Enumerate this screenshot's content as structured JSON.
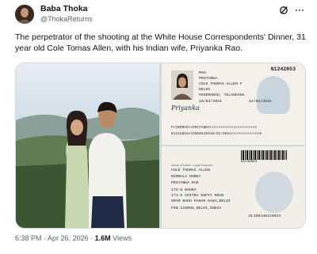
{
  "author": {
    "display_name": "Baba Thoka",
    "handle": "@ThokaReturns"
  },
  "header_icons": [
    "grok-icon",
    "more-icon"
  ],
  "tweet": {
    "text": "The perpetrator of the shooting at the White House Correspondents' Dinner, 31 year old Cole Tomas Allen, with his Indian wife, Priyanka Rao."
  },
  "passport_front": {
    "number": "N1242853",
    "fields": [
      "RAO",
      "PRIYANKA",
      "COLE THOMAS ALLEN F",
      "DELHI",
      "HYDERABAD, TELANGANA",
      "19/04/2024",
      "14/04/2034"
    ],
    "signature": "Priyanka",
    "mrz_line1": "P<INDRAO<<PRIYANKA<<<<<<<<<<<<<<<<<<<<<<",
    "mrz_line2": "N1242853<4IND6610910/02/0954<<<<<<<<<<<<<0"
  },
  "passport_back": {
    "number": "N1242853",
    "father_label": "Name of Father / Legal Guardian",
    "father": "COLE THOMAS ALLEN",
    "mother": "NIRMALA DUBEY",
    "spouse": "PRIYANKA RAO",
    "address1": "173-E BADKA",
    "address2": "173-E CHITRA GUPTA ROAD",
    "address3": "GRAM BADH PAHAR GANJ,DELHI",
    "pin": "PIN:110055,DELHI,INDIA",
    "file_no": "DL106346120924"
  },
  "meta": {
    "time": "6:38 PM",
    "separator": " · ",
    "date": "Apr 26, 2026",
    "views_count": "1.6M",
    "views_label": " Views"
  }
}
